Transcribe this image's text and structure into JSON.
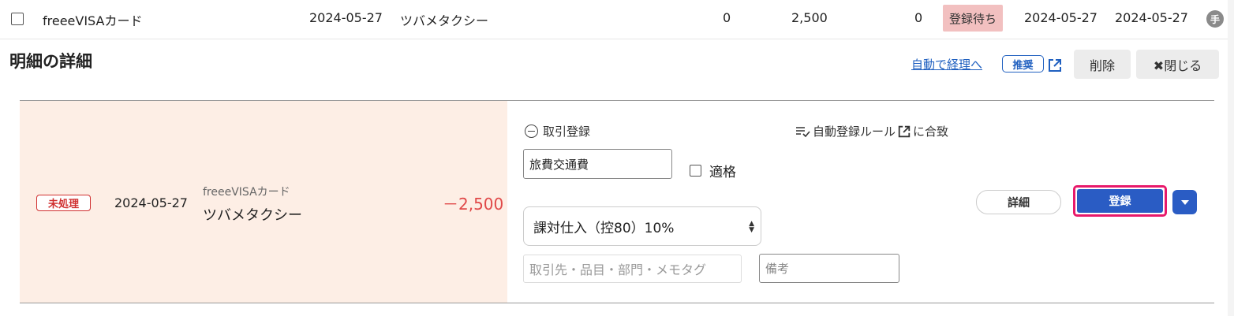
{
  "top_row": {
    "account": "freeeVISAカード",
    "date": "2024-05-27",
    "description": "ツバメタクシー",
    "col_zero_1": "0",
    "amount": "2,500",
    "col_zero_2": "0",
    "status": "登録待ち",
    "date2": "2024-05-27",
    "date3": "2024-05-27",
    "hand_label": "手"
  },
  "header": {
    "title": "明細の詳細",
    "auto_link": "自動で経理へ",
    "recommend": "推奨",
    "delete_label": "削除",
    "close_label": "✖閉じる"
  },
  "detail": {
    "status": "未処理",
    "date": "2024-05-27",
    "account": "freeeVISAカード",
    "description": "ツバメタクシー",
    "amount": "－2,500"
  },
  "form": {
    "deal_register": "取引登録",
    "auto_rule_prefix": "自動登録ルール",
    "auto_rule_suffix": "に合致",
    "account_item": "旅費交通費",
    "qualified_label": "適格",
    "tax_category": "課対仕入（控80）10%",
    "tags_placeholder": "取引先・品目・部門・メモタグ",
    "memo_placeholder": "備考",
    "detail_button": "詳細",
    "register_button": "登録"
  },
  "colors": {
    "accent": "#2a5cc4",
    "highlight_border": "#e8196b",
    "status_bg": "#f2c0c0",
    "panel_left_bg": "#fdeee5",
    "amount_negative": "#e04848"
  }
}
